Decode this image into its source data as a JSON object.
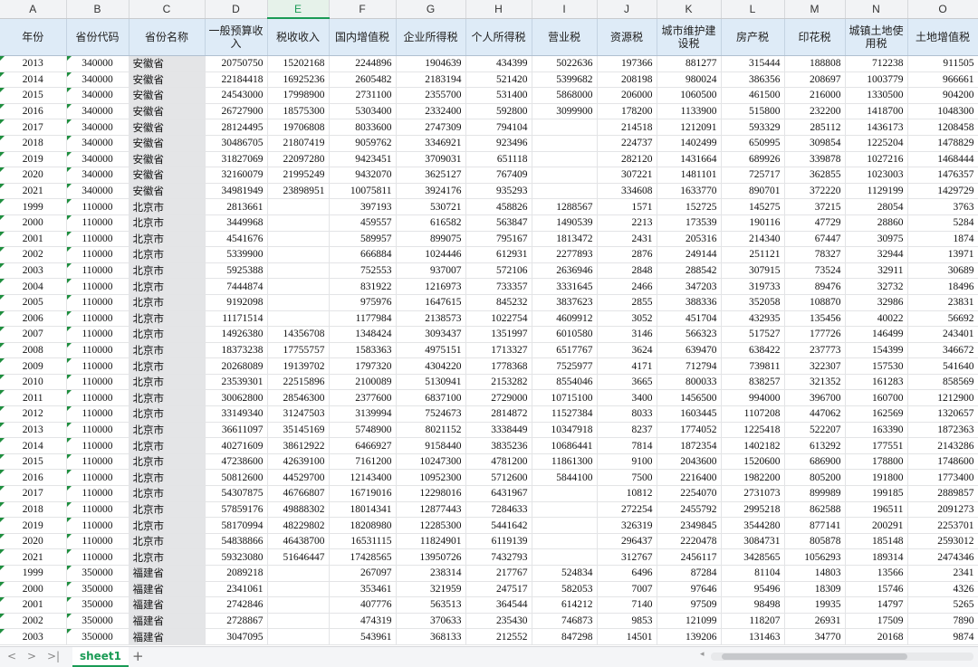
{
  "columns": [
    "A",
    "B",
    "C",
    "D",
    "E",
    "F",
    "G",
    "H",
    "I",
    "J",
    "K",
    "L",
    "M",
    "N",
    "O"
  ],
  "selected_column": "E",
  "header_row": [
    "年份",
    "省份代码",
    "省份名称",
    "一般预算收入",
    "税收收入",
    "国内增值税",
    "企业所得税",
    "个人所得税",
    "营业税",
    "资源税",
    "城市维护建设税",
    "房产税",
    "印花税",
    "城镇土地使用税",
    "土地增值税"
  ],
  "rows": [
    [
      "2013",
      "340000",
      "安徽省",
      "20750750",
      "15202168",
      "2244896",
      "1904639",
      "434399",
      "5022636",
      "197366",
      "881277",
      "315444",
      "188808",
      "712238",
      "911505"
    ],
    [
      "2014",
      "340000",
      "安徽省",
      "22184418",
      "16925236",
      "2605482",
      "2183194",
      "521420",
      "5399682",
      "208198",
      "980024",
      "386356",
      "208697",
      "1003779",
      "966661"
    ],
    [
      "2015",
      "340000",
      "安徽省",
      "24543000",
      "17998900",
      "2731100",
      "2355700",
      "531400",
      "5868000",
      "206000",
      "1060500",
      "461500",
      "216000",
      "1330500",
      "904200"
    ],
    [
      "2016",
      "340000",
      "安徽省",
      "26727900",
      "18575300",
      "5303400",
      "2332400",
      "592800",
      "3099900",
      "178200",
      "1133900",
      "515800",
      "232200",
      "1418700",
      "1048300"
    ],
    [
      "2017",
      "340000",
      "安徽省",
      "28124495",
      "19706808",
      "8033600",
      "2747309",
      "794104",
      "",
      "214518",
      "1212091",
      "593329",
      "285112",
      "1436173",
      "1208458"
    ],
    [
      "2018",
      "340000",
      "安徽省",
      "30486705",
      "21807419",
      "9059762",
      "3346921",
      "923496",
      "",
      "224737",
      "1402499",
      "650995",
      "309854",
      "1225204",
      "1478829"
    ],
    [
      "2019",
      "340000",
      "安徽省",
      "31827069",
      "22097280",
      "9423451",
      "3709031",
      "651118",
      "",
      "282120",
      "1431664",
      "689926",
      "339878",
      "1027216",
      "1468444"
    ],
    [
      "2020",
      "340000",
      "安徽省",
      "32160079",
      "21995249",
      "9432070",
      "3625127",
      "767409",
      "",
      "307221",
      "1481101",
      "725717",
      "362855",
      "1023003",
      "1476357"
    ],
    [
      "2021",
      "340000",
      "安徽省",
      "34981949",
      "23898951",
      "10075811",
      "3924176",
      "935293",
      "",
      "334608",
      "1633770",
      "890701",
      "372220",
      "1129199",
      "1429729"
    ],
    [
      "1999",
      "110000",
      "北京市",
      "2813661",
      "",
      "397193",
      "530721",
      "458826",
      "1288567",
      "1571",
      "152725",
      "145275",
      "37215",
      "28054",
      "3763"
    ],
    [
      "2000",
      "110000",
      "北京市",
      "3449968",
      "",
      "459557",
      "616582",
      "563847",
      "1490539",
      "2213",
      "173539",
      "190116",
      "47729",
      "28860",
      "5284"
    ],
    [
      "2001",
      "110000",
      "北京市",
      "4541676",
      "",
      "589957",
      "899075",
      "795167",
      "1813472",
      "2431",
      "205316",
      "214340",
      "67447",
      "30975",
      "1874"
    ],
    [
      "2002",
      "110000",
      "北京市",
      "5339900",
      "",
      "666884",
      "1024446",
      "612931",
      "2277893",
      "2876",
      "249144",
      "251121",
      "78327",
      "32944",
      "13971"
    ],
    [
      "2003",
      "110000",
      "北京市",
      "5925388",
      "",
      "752553",
      "937007",
      "572106",
      "2636946",
      "2848",
      "288542",
      "307915",
      "73524",
      "32911",
      "30689"
    ],
    [
      "2004",
      "110000",
      "北京市",
      "7444874",
      "",
      "831922",
      "1216973",
      "733357",
      "3331645",
      "2466",
      "347203",
      "319733",
      "89476",
      "32732",
      "18496"
    ],
    [
      "2005",
      "110000",
      "北京市",
      "9192098",
      "",
      "975976",
      "1647615",
      "845232",
      "3837623",
      "2855",
      "388336",
      "352058",
      "108870",
      "32986",
      "23831"
    ],
    [
      "2006",
      "110000",
      "北京市",
      "11171514",
      "",
      "1177984",
      "2138573",
      "1022754",
      "4609912",
      "3052",
      "451704",
      "432935",
      "135456",
      "40022",
      "56692"
    ],
    [
      "2007",
      "110000",
      "北京市",
      "14926380",
      "14356708",
      "1348424",
      "3093437",
      "1351997",
      "6010580",
      "3146",
      "566323",
      "517527",
      "177726",
      "146499",
      "243401"
    ],
    [
      "2008",
      "110000",
      "北京市",
      "18373238",
      "17755757",
      "1583363",
      "4975151",
      "1713327",
      "6517767",
      "3624",
      "639470",
      "638422",
      "237773",
      "154399",
      "346672"
    ],
    [
      "2009",
      "110000",
      "北京市",
      "20268089",
      "19139702",
      "1797320",
      "4304220",
      "1778368",
      "7525977",
      "4171",
      "712794",
      "739811",
      "322307",
      "157530",
      "541640"
    ],
    [
      "2010",
      "110000",
      "北京市",
      "23539301",
      "22515896",
      "2100089",
      "5130941",
      "2153282",
      "8554046",
      "3665",
      "800033",
      "838257",
      "321352",
      "161283",
      "858569"
    ],
    [
      "2011",
      "110000",
      "北京市",
      "30062800",
      "28546300",
      "2377600",
      "6837100",
      "2729000",
      "10715100",
      "3400",
      "1456500",
      "994000",
      "396700",
      "160700",
      "1212900"
    ],
    [
      "2012",
      "110000",
      "北京市",
      "33149340",
      "31247503",
      "3139994",
      "7524673",
      "2814872",
      "11527384",
      "8033",
      "1603445",
      "1107208",
      "447062",
      "162569",
      "1320657"
    ],
    [
      "2013",
      "110000",
      "北京市",
      "36611097",
      "35145169",
      "5748900",
      "8021152",
      "3338449",
      "10347918",
      "8237",
      "1774052",
      "1225418",
      "522207",
      "163390",
      "1872363"
    ],
    [
      "2014",
      "110000",
      "北京市",
      "40271609",
      "38612922",
      "6466927",
      "9158440",
      "3835236",
      "10686441",
      "7814",
      "1872354",
      "1402182",
      "613292",
      "177551",
      "2143286"
    ],
    [
      "2015",
      "110000",
      "北京市",
      "47238600",
      "42639100",
      "7161200",
      "10247300",
      "4781200",
      "11861300",
      "9100",
      "2043600",
      "1520600",
      "686900",
      "178800",
      "1748600"
    ],
    [
      "2016",
      "110000",
      "北京市",
      "50812600",
      "44529700",
      "12143400",
      "10952300",
      "5712600",
      "5844100",
      "7500",
      "2216400",
      "1982200",
      "805200",
      "191800",
      "1773400"
    ],
    [
      "2017",
      "110000",
      "北京市",
      "54307875",
      "46766807",
      "16719016",
      "12298016",
      "6431967",
      "",
      "10812",
      "2254070",
      "2731073",
      "899989",
      "199185",
      "2889857"
    ],
    [
      "2018",
      "110000",
      "北京市",
      "57859176",
      "49888302",
      "18014341",
      "12877443",
      "7284633",
      "",
      "272254",
      "2455792",
      "2995218",
      "862588",
      "196511",
      "2091273"
    ],
    [
      "2019",
      "110000",
      "北京市",
      "58170994",
      "48229802",
      "18208980",
      "12285300",
      "5441642",
      "",
      "326319",
      "2349845",
      "3544280",
      "877141",
      "200291",
      "2253701"
    ],
    [
      "2020",
      "110000",
      "北京市",
      "54838866",
      "46438700",
      "16531115",
      "11824901",
      "6119139",
      "",
      "296437",
      "2220478",
      "3084731",
      "805878",
      "185148",
      "2593012"
    ],
    [
      "2021",
      "110000",
      "北京市",
      "59323080",
      "51646447",
      "17428565",
      "13950726",
      "7432793",
      "",
      "312767",
      "2456117",
      "3428565",
      "1056293",
      "189314",
      "2474346"
    ],
    [
      "1999",
      "350000",
      "福建省",
      "2089218",
      "",
      "267097",
      "238314",
      "217767",
      "524834",
      "6496",
      "87284",
      "81104",
      "14803",
      "13566",
      "2341"
    ],
    [
      "2000",
      "350000",
      "福建省",
      "2341061",
      "",
      "353461",
      "321959",
      "247517",
      "582053",
      "7007",
      "97646",
      "95496",
      "18309",
      "15746",
      "4326"
    ],
    [
      "2001",
      "350000",
      "福建省",
      "2742846",
      "",
      "407776",
      "563513",
      "364544",
      "614212",
      "7140",
      "97509",
      "98498",
      "19935",
      "14797",
      "5265"
    ],
    [
      "2002",
      "350000",
      "福建省",
      "2728867",
      "",
      "474319",
      "370633",
      "235430",
      "746873",
      "9853",
      "121099",
      "118207",
      "26931",
      "17509",
      "7890"
    ],
    [
      "2003",
      "350000",
      "福建省",
      "3047095",
      "",
      "543961",
      "368133",
      "212552",
      "847298",
      "14501",
      "139206",
      "131463",
      "34770",
      "20168",
      "9874"
    ]
  ],
  "sheet_tab": "sheet1",
  "add_sheet": "+",
  "nav": {
    "prev": "<",
    "next": ">",
    "last": ">|"
  }
}
